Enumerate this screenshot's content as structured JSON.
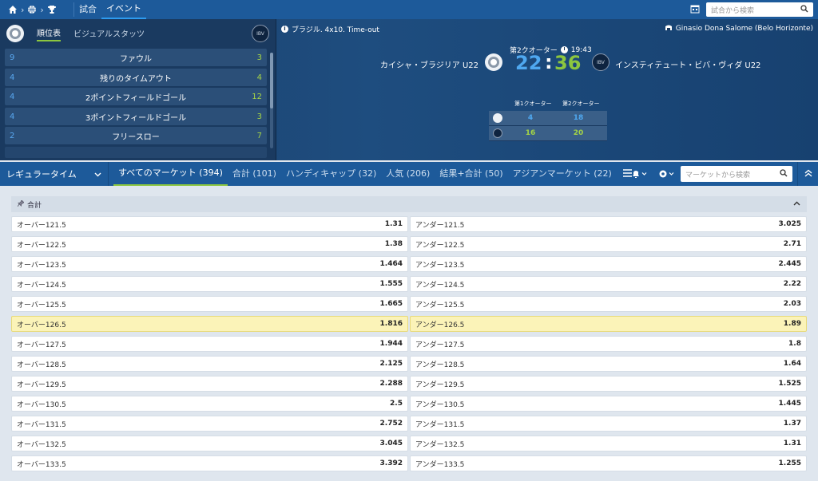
{
  "nav": {
    "tabs": [
      "試合",
      "イベント"
    ],
    "active": "イベント",
    "search_placeholder": "試合から検索"
  },
  "stats_panel": {
    "tabs": [
      "順位表",
      "ビジュアルスタッツ"
    ],
    "active": "順位表",
    "rows": [
      {
        "home": "9",
        "name": "ファウル",
        "away": "3"
      },
      {
        "home": "4",
        "name": "残りのタイムアウト",
        "away": "4"
      },
      {
        "home": "4",
        "name": "2ポイントフィールドゴール",
        "away": "12"
      },
      {
        "home": "4",
        "name": "3ポイントフィールドゴール",
        "away": "3"
      },
      {
        "home": "2",
        "name": "フリースロー",
        "away": "7"
      }
    ]
  },
  "event": {
    "incident": "ブラジル. 4x10. Time-out",
    "venue": "Ginasio Dona Salome (Belo Horizonte)",
    "period": "第2クオーター",
    "clock": "19:43",
    "home_team": "カイシャ・ブラジリア U22",
    "away_team": "インスティテュート・ビバ・ヴィダ U22",
    "home_score": "22",
    "away_score": "36",
    "quarter_headers": [
      "第1クオーター",
      "第2クオーター"
    ],
    "home_quarters": [
      "4",
      "18"
    ],
    "away_quarters": [
      "16",
      "20"
    ]
  },
  "markets_bar": {
    "period_select": "レギュラータイム",
    "tabs": [
      "すべてのマーケット (394)",
      "合計 (101)",
      "ハンディキャップ (32)",
      "人気 (206)",
      "結果+合計 (50)",
      "アジアンマーケット (22)"
    ],
    "active_tab": 0,
    "search_placeholder": "マーケットから検索"
  },
  "market": {
    "title": "合計",
    "rows": [
      {
        "over": "オーバー121.5",
        "over_odd": "1.31",
        "under": "アンダー121.5",
        "under_odd": "3.025"
      },
      {
        "over": "オーバー122.5",
        "over_odd": "1.38",
        "under": "アンダー122.5",
        "under_odd": "2.71"
      },
      {
        "over": "オーバー123.5",
        "over_odd": "1.464",
        "under": "アンダー123.5",
        "under_odd": "2.445"
      },
      {
        "over": "オーバー124.5",
        "over_odd": "1.555",
        "under": "アンダー124.5",
        "under_odd": "2.22"
      },
      {
        "over": "オーバー125.5",
        "over_odd": "1.665",
        "under": "アンダー125.5",
        "under_odd": "2.03"
      },
      {
        "over": "オーバー126.5",
        "over_odd": "1.816",
        "under": "アンダー126.5",
        "under_odd": "1.89",
        "highlight": true
      },
      {
        "over": "オーバー127.5",
        "over_odd": "1.944",
        "under": "アンダー127.5",
        "under_odd": "1.8"
      },
      {
        "over": "オーバー128.5",
        "over_odd": "2.125",
        "under": "アンダー128.5",
        "under_odd": "1.64"
      },
      {
        "over": "オーバー129.5",
        "over_odd": "2.288",
        "under": "アンダー129.5",
        "under_odd": "1.525"
      },
      {
        "over": "オーバー130.5",
        "over_odd": "2.5",
        "under": "アンダー130.5",
        "under_odd": "1.445"
      },
      {
        "over": "オーバー131.5",
        "over_odd": "2.752",
        "under": "アンダー131.5",
        "under_odd": "1.37"
      },
      {
        "over": "オーバー132.5",
        "over_odd": "3.045",
        "under": "アンダー132.5",
        "under_odd": "1.31"
      },
      {
        "over": "オーバー133.5",
        "over_odd": "3.392",
        "under": "アンダー133.5",
        "under_odd": "1.255"
      }
    ]
  },
  "colors": {
    "nav_blue": "#1d5a9a",
    "home_blue": "#4fa8f0",
    "away_green": "#8cc63f",
    "highlight": "#fbf3b8"
  },
  "icons": [
    "home-icon",
    "basketball-icon",
    "trophy-icon",
    "calendar-icon",
    "search-icon",
    "info-icon",
    "stadium-icon",
    "clock-icon",
    "menu-icon",
    "bell-icon",
    "gear-icon",
    "pin-icon",
    "chevron-up-icon"
  ]
}
